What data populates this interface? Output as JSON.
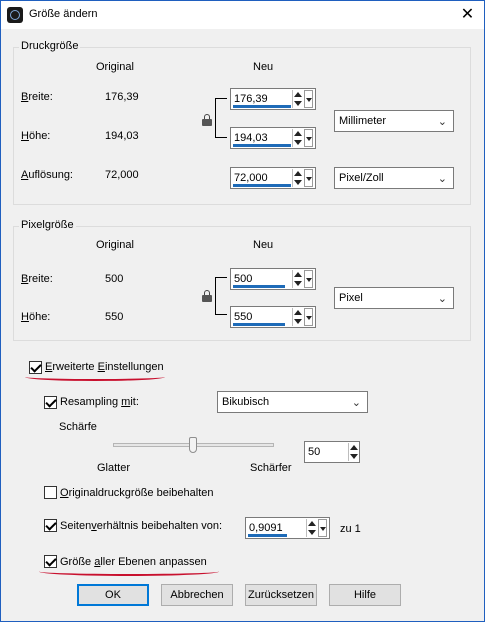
{
  "window": {
    "title": "Größe ändern",
    "close_glyph": "✕",
    "icon": "app-icon"
  },
  "druckgroesse": {
    "group_title": "Druckgröße",
    "col_original": "Original",
    "col_neu": "Neu",
    "breite_label": "Breite:",
    "breite_original": "176,39",
    "breite_neu": "176,39",
    "hoehe_label": "Höhe:",
    "hoehe_original": "194,03",
    "hoehe_neu": "194,03",
    "unit_select": "Millimeter",
    "aufloesung_label": "Auflösung:",
    "aufloesung_original": "72,000",
    "aufloesung_neu": "72,000",
    "aufloesung_unit": "Pixel/Zoll"
  },
  "pixelgroesse": {
    "group_title": "Pixelgröße",
    "col_original": "Original",
    "col_neu": "Neu",
    "breite_label": "Breite:",
    "breite_original": "500",
    "breite_neu": "500",
    "hoehe_label": "Höhe:",
    "hoehe_original": "550",
    "hoehe_neu": "550",
    "unit_select": "Pixel"
  },
  "erweitert": {
    "label": "Erweiterte Einstellungen",
    "checked": true
  },
  "resampling": {
    "label": "Resampling mit:",
    "checked": true,
    "method": "Bikubisch"
  },
  "schaerfe": {
    "label": "Schärfe",
    "min_label": "Glatter",
    "max_label": "Schärfer",
    "value": "50",
    "slider_fraction": 0.5
  },
  "options": {
    "original_druck": "Originaldruckgröße beibehalten",
    "original_druck_checked": false,
    "seitenverhaeltnis": "Seitenverhältnis beibehalten von:",
    "seitenverhaeltnis_checked": true,
    "ratio_value": "0,9091",
    "ratio_suffix": "zu 1",
    "ebenen": "Größe aller Ebenen anpassen",
    "ebenen_checked": true
  },
  "buttons": {
    "ok": "OK",
    "abbrechen": "Abbrechen",
    "zuruecksetzen": "Zurücksetzen",
    "hilfe": "Hilfe"
  },
  "colors": {
    "accent": "#0078d7",
    "value_underline": "#1e6bb8",
    "annotation_red": "#c8102e"
  }
}
